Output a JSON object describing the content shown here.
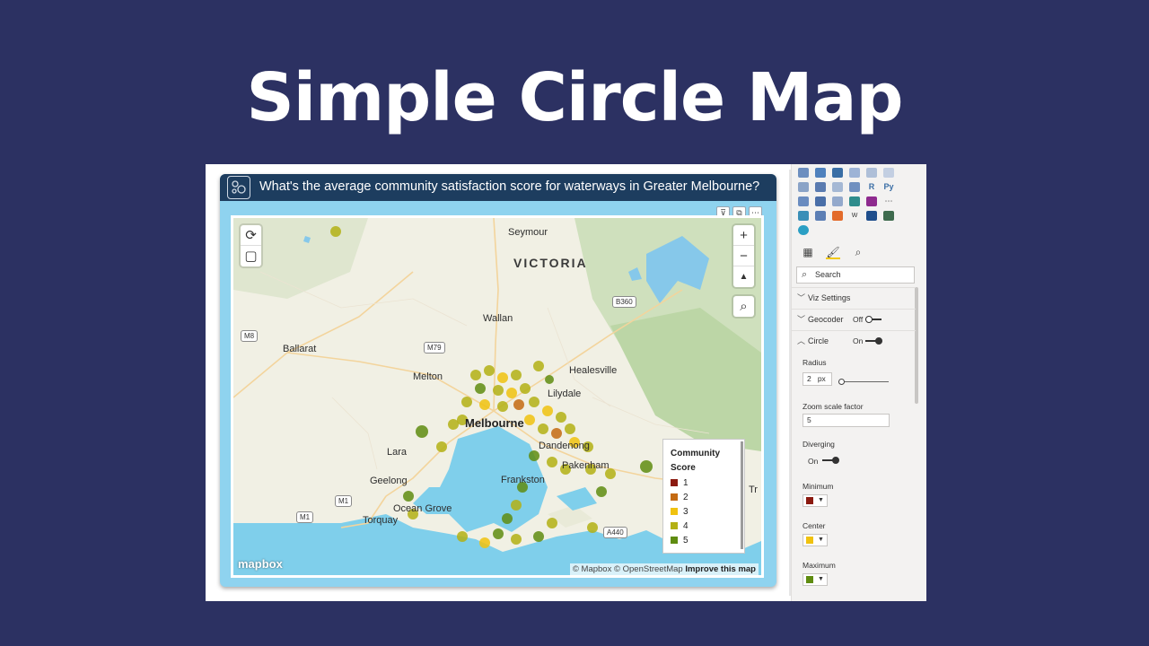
{
  "hero": {
    "title": "Simple Circle Map"
  },
  "visual": {
    "title": "What's the average community satisfaction score for waterways in Greater Melbourne?",
    "tools": [
      "filter-icon",
      "focus-mode-icon",
      "more-options-icon"
    ],
    "tool_glyphs": [
      "⊽",
      "⧉",
      "⋯"
    ]
  },
  "map": {
    "places": {
      "state": "VICTORIA",
      "seymour": "Seymour",
      "wallan": "Wallan",
      "ballarat": "Ballarat",
      "melton": "Melton",
      "healesville": "Healesville",
      "lilydale": "Lilydale",
      "melbourne": "Melbourne",
      "dandenong": "Dandenong",
      "pakenham": "Pakenham",
      "lara": "Lara",
      "geelong": "Geelong",
      "frankston": "Frankston",
      "ocean_grove": "Ocean Grove",
      "torquay": "Torquay",
      "tr": "Tr"
    },
    "roads": {
      "b360": "B360",
      "m8": "M8",
      "m79": "M79",
      "m1a": "M1",
      "m1b": "M1",
      "a440": "A440"
    },
    "controls": {
      "zoom_in": "+",
      "zoom_out": "−",
      "compass": "▲",
      "search": "⌕",
      "lasso": "⟳",
      "box": "▢"
    },
    "legend": {
      "title_1": "Community",
      "title_2": "Score",
      "items": [
        {
          "label": "1",
          "color": "#8b1a10"
        },
        {
          "label": "2",
          "color": "#c46a12"
        },
        {
          "label": "3",
          "color": "#f0c20f"
        },
        {
          "label": "4",
          "color": "#b3b014"
        },
        {
          "label": "5",
          "color": "#5f8c10"
        }
      ]
    },
    "logo": "mapbox",
    "attribution": "© Mapbox © OpenStreetMap",
    "improve": "Improve this map"
  },
  "pane": {
    "search_placeholder": "Search",
    "tabs": [
      "fields-icon",
      "format-paint-icon",
      "analytics-icon"
    ],
    "sections": {
      "viz_settings": "Viz Settings",
      "geocoder": "Geocoder",
      "geocoder_state": "Off",
      "circle": "Circle",
      "circle_state": "On"
    },
    "radius": {
      "label": "Radius",
      "value": "2",
      "unit": "px"
    },
    "zoom_scale": {
      "label": "Zoom scale factor",
      "value": "5"
    },
    "diverging": {
      "label": "Diverging",
      "state": "On"
    },
    "minimum": {
      "label": "Minimum",
      "color": "#8b1a10"
    },
    "center": {
      "label": "Center",
      "color": "#f0c20f"
    },
    "maximum": {
      "label": "Maximum",
      "color": "#5f8c10"
    },
    "viz_glyphs": [
      "R",
      "Py",
      "W"
    ]
  },
  "colors": {
    "background": "#2c3162",
    "header": "#1d3d5f",
    "border": "#8fd3ef",
    "water": "#7fcfeb"
  }
}
